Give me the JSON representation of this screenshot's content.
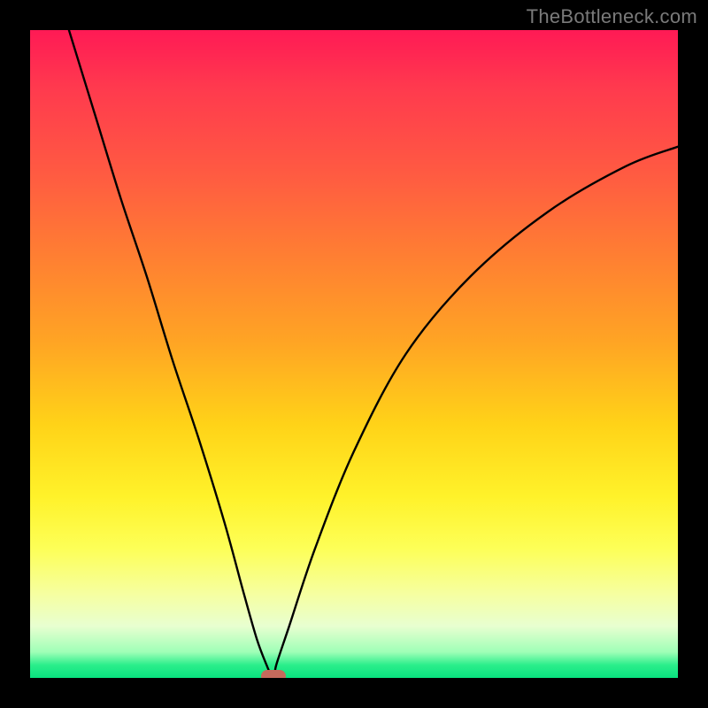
{
  "watermark": "TheBottleneck.com",
  "chart_data": {
    "type": "line",
    "title": "",
    "xlabel": "",
    "ylabel": "",
    "xlim": [
      0,
      100
    ],
    "ylim": [
      0,
      100
    ],
    "grid": false,
    "legend": false,
    "series": [
      {
        "name": "bottleneck-curve",
        "x": [
          6,
          10,
          14,
          18,
          22,
          26,
          30,
          33,
          35,
          36.5,
          37.2,
          37.8,
          38,
          40,
          44,
          50,
          58,
          68,
          80,
          92,
          100
        ],
        "y": [
          100,
          87,
          74,
          62,
          49,
          37,
          24,
          13,
          6,
          2,
          0.5,
          0.5,
          2,
          8,
          20,
          35,
          50,
          62,
          72,
          79,
          82
        ]
      }
    ],
    "marker": {
      "x": 37.5,
      "y": 0.3
    },
    "gradient_stops": [
      {
        "pos": 0,
        "rgb": "#ff1a55"
      },
      {
        "pos": 9,
        "rgb": "#ff3a4e"
      },
      {
        "pos": 22,
        "rgb": "#ff5a42"
      },
      {
        "pos": 35,
        "rgb": "#ff7f32"
      },
      {
        "pos": 48,
        "rgb": "#ffa424"
      },
      {
        "pos": 61,
        "rgb": "#ffd318"
      },
      {
        "pos": 72,
        "rgb": "#fff22a"
      },
      {
        "pos": 80,
        "rgb": "#fdff57"
      },
      {
        "pos": 87,
        "rgb": "#f6ffa0"
      },
      {
        "pos": 92,
        "rgb": "#e8ffd0"
      },
      {
        "pos": 96,
        "rgb": "#9fffb7"
      },
      {
        "pos": 98,
        "rgb": "#2bee8b"
      },
      {
        "pos": 100,
        "rgb": "#09e27f"
      }
    ]
  }
}
